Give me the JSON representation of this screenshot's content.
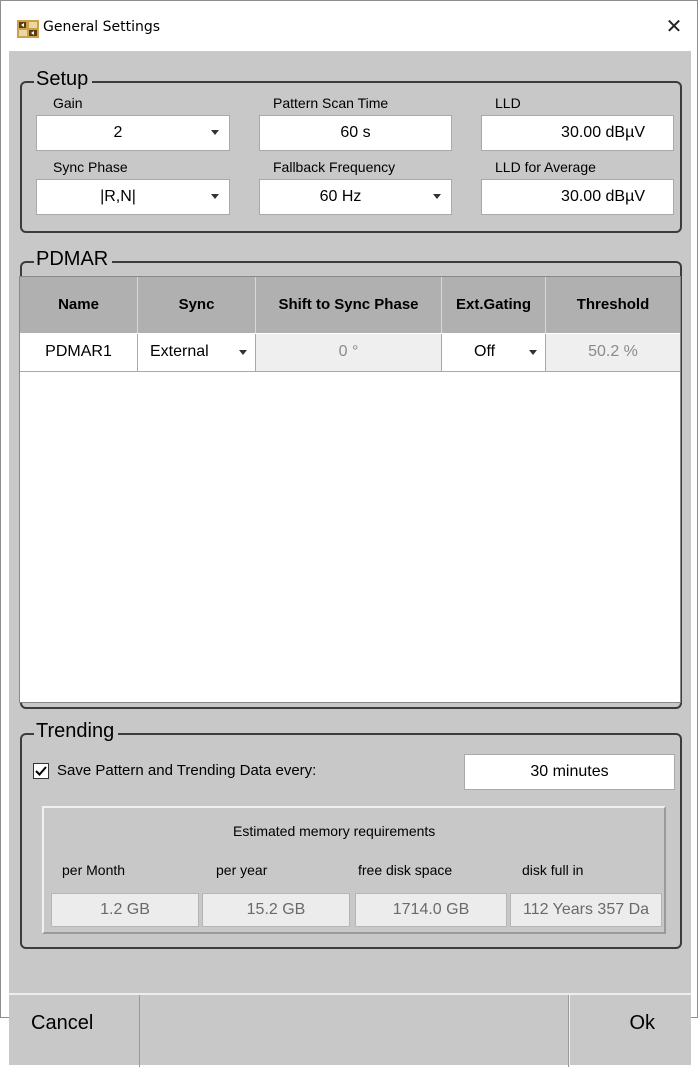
{
  "window": {
    "title": "General Settings",
    "close_glyph": "✕",
    "icon": "app-icon"
  },
  "setup": {
    "title": "Setup",
    "gain": {
      "label": "Gain",
      "value": "2"
    },
    "pattern_scan_time": {
      "label": "Pattern Scan Time",
      "value": "60 s"
    },
    "lld": {
      "label": "LLD",
      "value": "30.00 dBµV"
    },
    "sync_phase": {
      "label": "Sync Phase",
      "value": "|R,N|"
    },
    "fallback_frequency": {
      "label": "Fallback Frequency",
      "value": "60 Hz"
    },
    "lld_average": {
      "label": "LLD for Average",
      "value": "30.00 dBµV"
    }
  },
  "pdmar": {
    "title": "PDMAR",
    "columns": [
      "Name",
      "Sync",
      "Shift to Sync Phase",
      "Ext.Gating",
      "Threshold"
    ],
    "rows": [
      {
        "name": "PDMAR1",
        "sync": "External",
        "shift": "0 °",
        "ext_gating": "Off",
        "threshold": "50.2 %"
      }
    ]
  },
  "trending": {
    "title": "Trending",
    "save_checked": true,
    "save_label": "Save Pattern and Trending Data every:",
    "interval": "30 minutes",
    "memory": {
      "title": "Estimated memory requirements",
      "per_month_label": "per Month",
      "per_year_label": "per year",
      "free_disk_label": "free disk space",
      "disk_full_label": "disk full in",
      "per_month": "1.2 GB",
      "per_year": "15.2 GB",
      "free_disk": "1714.0 GB",
      "disk_full": "112 Years 357 Da"
    }
  },
  "buttons": {
    "cancel": "Cancel",
    "ok": "Ok"
  },
  "colors": {
    "panel": "#c8c8c8",
    "header": "#b0b0b0",
    "disabled": "#efefef"
  }
}
